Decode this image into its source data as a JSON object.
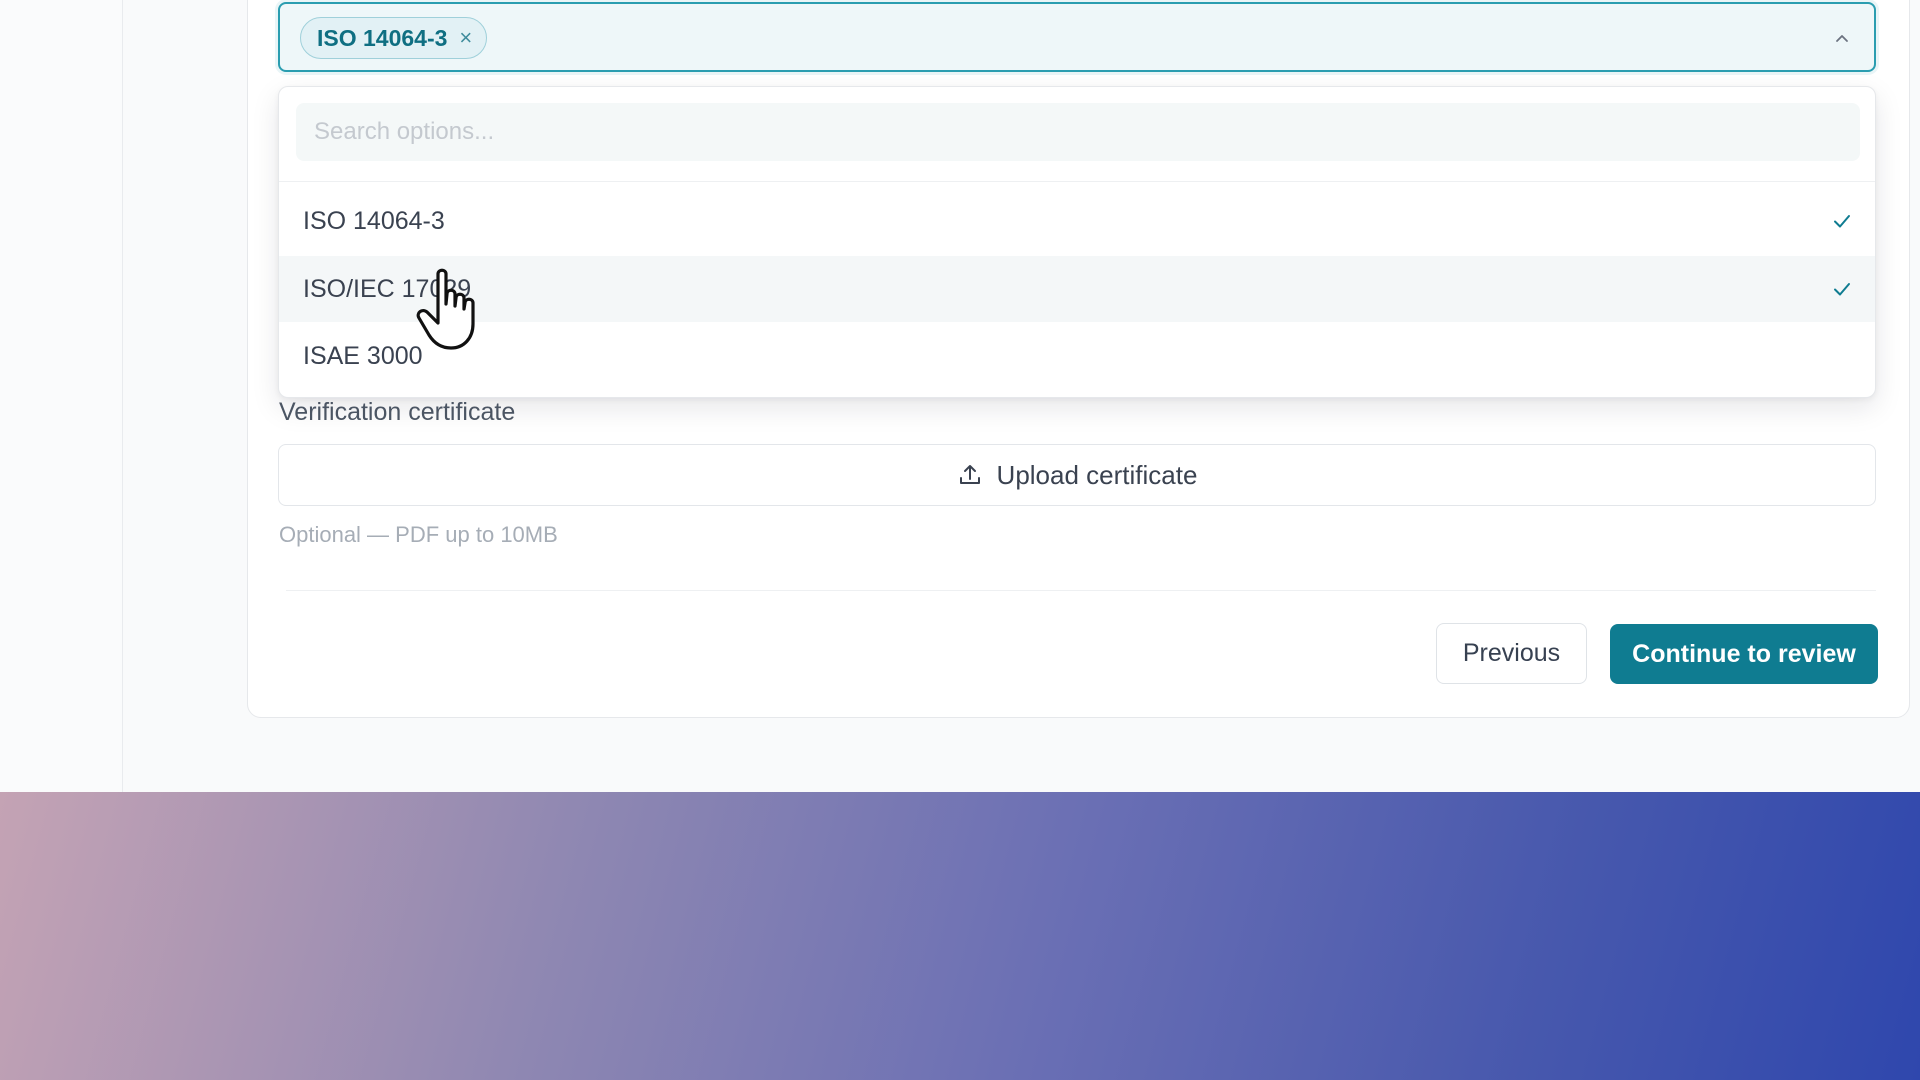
{
  "standards_select": {
    "selected_chip": "ISO 14064-3",
    "chip_remove_icon": "×",
    "search_placeholder": "Search options...",
    "options": [
      {
        "label": "ISO 14064-3",
        "checked": true
      },
      {
        "label": "ISO/IEC 17029",
        "checked": true
      },
      {
        "label": "ISAE 3000",
        "checked": false
      }
    ],
    "hovered_option": "ISO/IEC 17029"
  },
  "certificate": {
    "label": "Verification certificate",
    "upload_label": "Upload certificate",
    "hint": "Optional — PDF up to 10MB"
  },
  "footer": {
    "previous_label": "Previous",
    "continue_label": "Continue to review"
  },
  "colors": {
    "accent": "#0f7c91",
    "focus_border": "#2a9db0",
    "chip_text": "#0f6f82"
  },
  "icons": {
    "caret": "chevron-up-icon",
    "check": "check-icon",
    "upload": "upload-icon",
    "remove": "close-icon",
    "pointer": "hand-cursor-icon"
  }
}
